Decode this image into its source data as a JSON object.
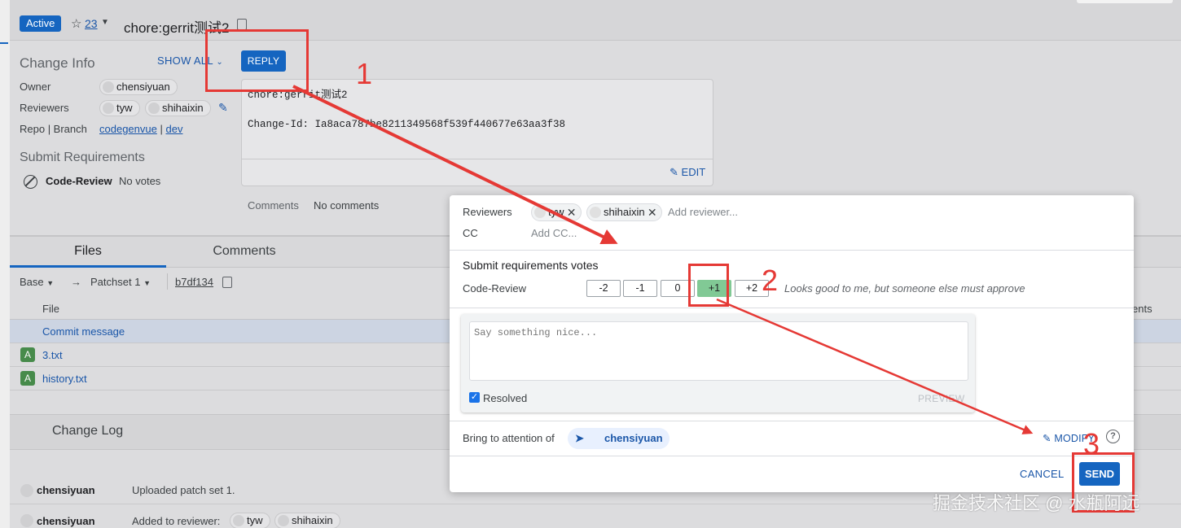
{
  "header": {
    "status": "Active",
    "star_icon": "star-icon",
    "star_count": "23",
    "subject": "chore:gerrit测试2"
  },
  "change_info": {
    "title": "Change Info",
    "show_all": "SHOW ALL",
    "reply": "REPLY",
    "owner_label": "Owner",
    "owner": "chensiyuan",
    "reviewers_label": "Reviewers",
    "reviewers": [
      "tyw",
      "shihaixin"
    ],
    "repo_branch_label": "Repo | Branch",
    "repo": "codegenvue",
    "separator": "|",
    "branch": "dev"
  },
  "submit_requirements": {
    "title": "Submit Requirements",
    "name": "Code-Review",
    "value": "No votes"
  },
  "commit": {
    "message": "chore:gerrit测试2\n\nChange-Id: Ia8aca787be8211349568f539f440677e63aa3f38",
    "edit": "EDIT",
    "comments_label": "Comments",
    "comments_value": "No comments"
  },
  "tabs": {
    "files": "Files",
    "comments": "Comments"
  },
  "files_toolbar": {
    "base": "Base",
    "arrow": "→",
    "patchset": "Patchset 1",
    "commit_hash": "b7df134"
  },
  "files_table": {
    "header": "File",
    "right_header": "ents",
    "rows": [
      {
        "badge": "",
        "name": "Commit message"
      },
      {
        "badge": "A",
        "name": "3.txt"
      },
      {
        "badge": "A",
        "name": "history.txt"
      }
    ]
  },
  "change_log": {
    "title": "Change Log",
    "entries": [
      {
        "author": "chensiyuan",
        "message": "Uploaded patch set 1."
      },
      {
        "author": "chensiyuan",
        "message": "Added to reviewer:",
        "chips": [
          "tyw",
          "shihaixin"
        ]
      }
    ]
  },
  "reply_dialog": {
    "reviewers_label": "Reviewers",
    "reviewers": [
      "tyw",
      "shihaixin"
    ],
    "add_reviewer": "Add reviewer...",
    "cc_label": "CC",
    "add_cc": "Add CC...",
    "votes_title": "Submit requirements votes",
    "vote_label": "Code-Review",
    "votes": [
      "-2",
      "-1",
      "0",
      "+1",
      "+2"
    ],
    "selected_vote": "+1",
    "vote_description": "Looks good to me, but someone else must approve",
    "message_placeholder": "Say something nice...",
    "resolved_label": "Resolved",
    "resolved_checked": true,
    "preview": "PREVIEW",
    "attention_label": "Bring to attention of",
    "attention_user": "chensiyuan",
    "modify": "MODIFY",
    "help_icon": "help-circle-icon",
    "cancel": "CANCEL",
    "send": "SEND"
  },
  "annotations": {
    "step1": "1",
    "step2": "2",
    "step3": "3",
    "color": "#e53935"
  },
  "watermark": "掘金技术社区 @ 水瓶阿远",
  "colors": {
    "accent": "#1565c0",
    "link": "#1a56a8",
    "vote_selected": "#81c995",
    "file_added": "#2e7d32"
  }
}
